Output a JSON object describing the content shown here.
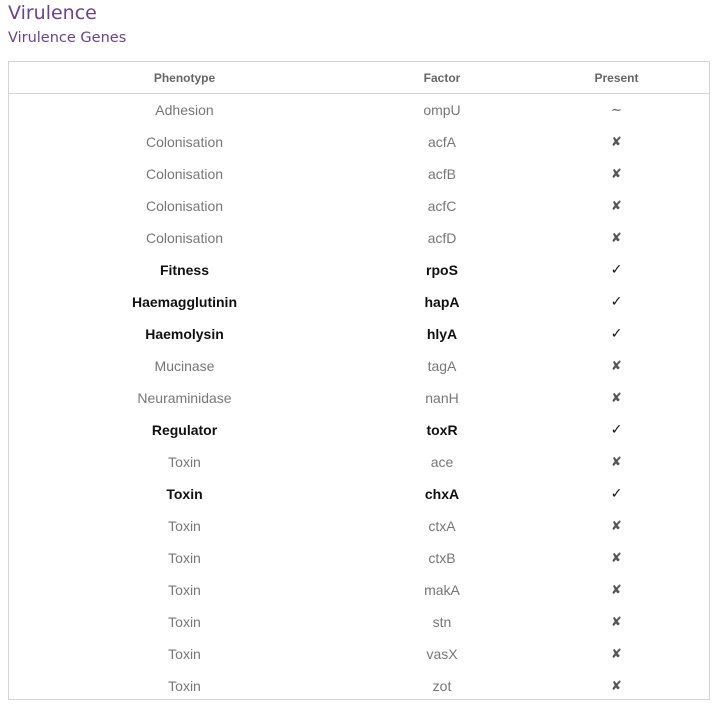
{
  "header": {
    "title": "Virulence",
    "subtitle": "Virulence Genes"
  },
  "table": {
    "columns": [
      "Phenotype",
      "Factor",
      "Present"
    ],
    "rows": [
      {
        "phenotype": "Adhesion",
        "factor": "ompU",
        "present": "∼",
        "status": "partial"
      },
      {
        "phenotype": "Colonisation",
        "factor": "acfA",
        "present": "✘",
        "status": "absent"
      },
      {
        "phenotype": "Colonisation",
        "factor": "acfB",
        "present": "✘",
        "status": "absent"
      },
      {
        "phenotype": "Colonisation",
        "factor": "acfC",
        "present": "✘",
        "status": "absent"
      },
      {
        "phenotype": "Colonisation",
        "factor": "acfD",
        "present": "✘",
        "status": "absent"
      },
      {
        "phenotype": "Fitness",
        "factor": "rpoS",
        "present": "✓",
        "status": "present"
      },
      {
        "phenotype": "Haemagglutinin",
        "factor": "hapA",
        "present": "✓",
        "status": "present"
      },
      {
        "phenotype": "Haemolysin",
        "factor": "hlyA",
        "present": "✓",
        "status": "present"
      },
      {
        "phenotype": "Mucinase",
        "factor": "tagA",
        "present": "✘",
        "status": "absent"
      },
      {
        "phenotype": "Neuraminidase",
        "factor": "nanH",
        "present": "✘",
        "status": "absent"
      },
      {
        "phenotype": "Regulator",
        "factor": "toxR",
        "present": "✓",
        "status": "present"
      },
      {
        "phenotype": "Toxin",
        "factor": "ace",
        "present": "✘",
        "status": "absent"
      },
      {
        "phenotype": "Toxin",
        "factor": "chxA",
        "present": "✓",
        "status": "present"
      },
      {
        "phenotype": "Toxin",
        "factor": "ctxA",
        "present": "✘",
        "status": "absent"
      },
      {
        "phenotype": "Toxin",
        "factor": "ctxB",
        "present": "✘",
        "status": "absent"
      },
      {
        "phenotype": "Toxin",
        "factor": "makA",
        "present": "✘",
        "status": "absent"
      },
      {
        "phenotype": "Toxin",
        "factor": "stn",
        "present": "✘",
        "status": "absent"
      },
      {
        "phenotype": "Toxin",
        "factor": "vasX",
        "present": "✘",
        "status": "absent"
      },
      {
        "phenotype": "Toxin",
        "factor": "zot",
        "present": "✘",
        "status": "absent"
      }
    ]
  },
  "colors": {
    "title": "#6a4292",
    "border": "#d4d4d4",
    "muted_text": "#777777",
    "present_text": "#111111"
  }
}
